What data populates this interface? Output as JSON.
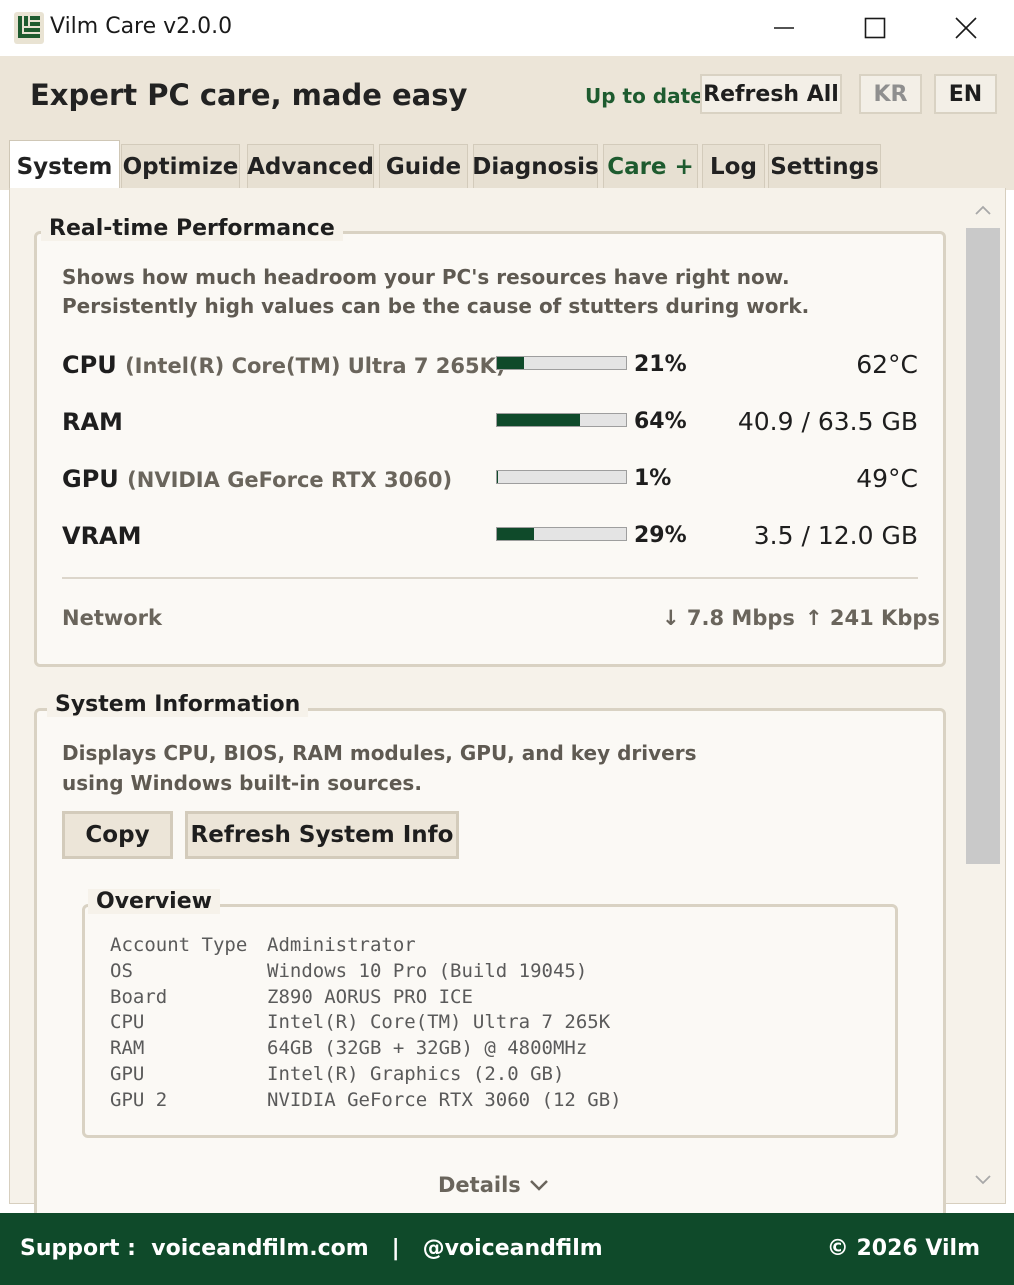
{
  "window": {
    "title": "Vilm Care v2.0.0"
  },
  "header": {
    "tagline": "Expert PC care, made easy",
    "status": "Up to date",
    "refresh_all": "Refresh All",
    "lang_kr": "KR",
    "lang_en": "EN"
  },
  "tabs": [
    {
      "label": "System",
      "active": true
    },
    {
      "label": "Optimize"
    },
    {
      "label": "Advanced"
    },
    {
      "label": "Guide"
    },
    {
      "label": "Diagnosis"
    },
    {
      "label": "Care +"
    },
    {
      "label": "Log"
    },
    {
      "label": "Settings"
    }
  ],
  "performance": {
    "title": "Real-time Performance",
    "description": "Shows how much headroom your PC's resources have right now. Persistently high values can be the cause of stutters during work.",
    "metrics": [
      {
        "name": "CPU",
        "detail": "(Intel(R) Core(TM) Ultra 7 265K)",
        "percent_label": "21%",
        "level": 0.21,
        "value": "62°C"
      },
      {
        "name": "RAM",
        "detail": "",
        "percent_label": "64%",
        "level": 0.64,
        "value": "40.9 / 63.5 GB"
      },
      {
        "name": "GPU",
        "detail": "(NVIDIA GeForce RTX 3060)",
        "percent_label": "1%",
        "level": 0.01,
        "value": "49°C"
      },
      {
        "name": "VRAM",
        "detail": "",
        "percent_label": "29%",
        "level": 0.29,
        "value": "3.5 / 12.0 GB"
      }
    ],
    "network": {
      "label": "Network",
      "down": "↓ 7.8 Mbps",
      "up": "↑ 241 Kbps"
    }
  },
  "system_info": {
    "title": "System Information",
    "description_line1": "Displays CPU, BIOS, RAM modules, GPU, and key drivers",
    "description_line2": "using Windows built-in sources.",
    "copy_button": "Copy",
    "refresh_button": "Refresh System Info",
    "overview": {
      "title": "Overview",
      "rows": [
        {
          "key": "Account Type",
          "value": "Administrator"
        },
        {
          "key": "OS",
          "value": "Windows 10 Pro (Build 19045)"
        },
        {
          "key": "Board",
          "value": "Z890 AORUS PRO ICE"
        },
        {
          "key": "CPU",
          "value": "Intel(R) Core(TM) Ultra 7 265K"
        },
        {
          "key": "RAM",
          "value": "64GB (32GB + 32GB) @ 4800MHz"
        },
        {
          "key": "GPU",
          "value": "Intel(R) Graphics (2.0 GB)"
        },
        {
          "key": "GPU 2",
          "value": "NVIDIA GeForce RTX 3060 (12 GB)"
        }
      ]
    },
    "details_label": "Details"
  },
  "footer": {
    "support_label": "Support :  voiceandfilm.com   |   @voiceandfilm",
    "copyright": "© 2026 Vilm"
  },
  "colors": {
    "accent_green": "#0f4a2a",
    "status_green": "#1e5b2f",
    "header_bg": "#ece5d8"
  },
  "icons": {
    "app": "vilm-logo-icon",
    "minimize": "minimize-icon",
    "maximize": "maximize-icon",
    "close": "close-icon",
    "scroll_up": "chevron-up-icon",
    "scroll_down": "chevron-down-icon",
    "details": "chevron-down-icon"
  }
}
